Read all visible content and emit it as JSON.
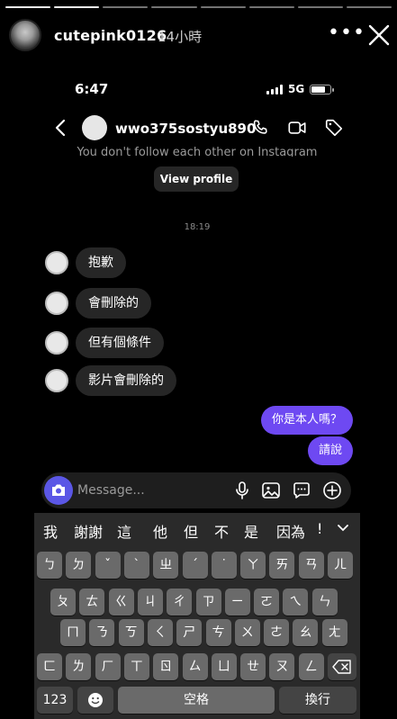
{
  "story": {
    "username": "cutepink0126",
    "time": "14小時",
    "more_label": "•••",
    "segments_total": 8,
    "segments_done": 2
  },
  "status": {
    "time": "6:47",
    "network": "5G",
    "battery_level": 0.8
  },
  "dm": {
    "contact_name": "wwo375sostyu890",
    "follow_note": "You don't follow each other on Instagram",
    "view_profile_label": "View profile",
    "timestamp": "18:19",
    "received": [
      "抱歉",
      "會刪除的",
      "但有個條件",
      "影片會刪除的"
    ],
    "sent": [
      "你是本人嗎？",
      "請說"
    ]
  },
  "composer": {
    "placeholder": "Message..."
  },
  "keyboard": {
    "suggestions": [
      "我",
      "謝謝",
      "這",
      "他",
      "但",
      "不",
      "是",
      "因為",
      "!"
    ],
    "row1": [
      "ㄅ",
      "ㄉ",
      "ˇ",
      "ˋ",
      "ㄓ",
      "ˊ",
      "˙",
      "ㄚ",
      "ㄞ",
      "ㄢ",
      "ㄦ"
    ],
    "row2": [
      "ㄆ",
      "ㄊ",
      "ㄍ",
      "ㄐ",
      "ㄔ",
      "ㄗ",
      "ㄧ",
      "ㄛ",
      "ㄟ",
      "ㄣ"
    ],
    "row3": [
      "ㄇ",
      "ㄋ",
      "ㄎ",
      "ㄑ",
      "ㄕ",
      "ㄘ",
      "ㄨ",
      "ㄜ",
      "ㄠ",
      "ㄤ"
    ],
    "row4": [
      "ㄈ",
      "ㄌ",
      "ㄏ",
      "ㄒ",
      "ㄖ",
      "ㄙ",
      "ㄩ",
      "ㄝ",
      "ㄡ",
      "ㄥ"
    ],
    "numbers_label": "123",
    "space_label": "空格",
    "return_label": "換行"
  },
  "colors": {
    "sent_bubble": "#6e49f2",
    "camera_button": "#5b57e6"
  }
}
